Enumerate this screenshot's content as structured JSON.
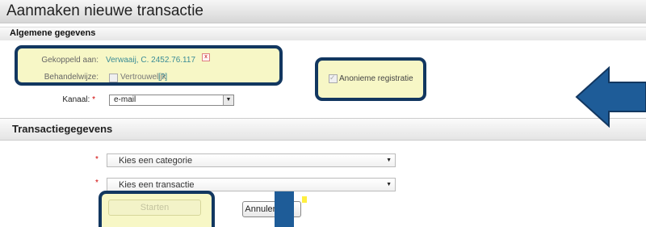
{
  "header": {
    "title": "Aanmaken nieuwe transactie"
  },
  "general": {
    "section_title": "Algemene gegevens",
    "linked_label": "Gekoppeld aan:",
    "linked_value": "Verwaaij, C. 2452.76.117",
    "handling_label": "Behandelwijze:",
    "confidential_label": "Vertrouwelijk",
    "help_text": "[?]",
    "anonymous_label": "Anonieme registratie",
    "channel_label": "Kanaal:",
    "required_marker": "*",
    "channel_value": "e-mail"
  },
  "transaction": {
    "section_title": "Transactiegegevens",
    "required_marker": "*",
    "category_placeholder": "Kies een categorie",
    "transaction_placeholder": "Kies een transactie",
    "start_label": "Starten",
    "cancel_label": "Annuleren"
  },
  "colors": {
    "highlight_border": "#123760",
    "highlight_fill": "#f7f7c6",
    "arrow": "#1e5c98"
  },
  "icons": {
    "arrow_left": "arrow-left-icon",
    "arrow_down": "arrow-down-icon",
    "dropdown": "chevron-down-icon"
  }
}
